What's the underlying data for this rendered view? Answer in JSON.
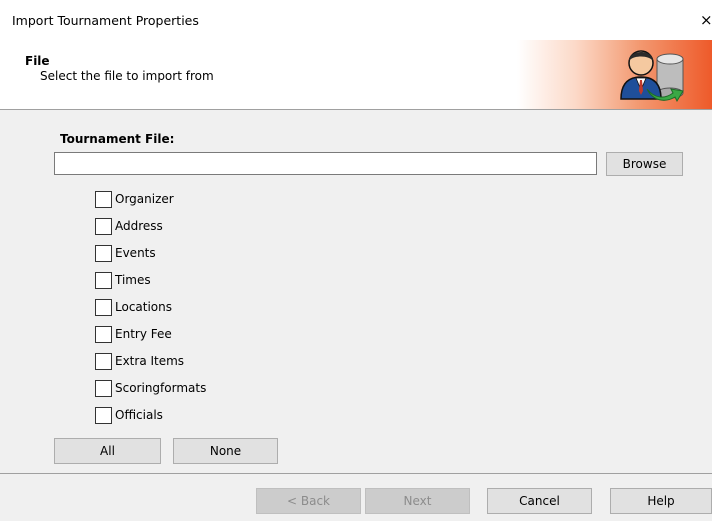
{
  "window": {
    "title": "Import Tournament Properties",
    "close_glyph": "×"
  },
  "header": {
    "title": "File",
    "subtitle": "Select the file to import from",
    "icon": "user-database-arrow-icon"
  },
  "form": {
    "file_label": "Tournament File:",
    "file_value": "",
    "browse_label": "Browse"
  },
  "checkboxes": [
    {
      "label": "Organizer",
      "checked": false
    },
    {
      "label": "Address",
      "checked": false
    },
    {
      "label": "Events",
      "checked": false
    },
    {
      "label": "Times",
      "checked": false
    },
    {
      "label": "Locations",
      "checked": false
    },
    {
      "label": "Entry Fee",
      "checked": false
    },
    {
      "label": "Extra Items",
      "checked": false
    },
    {
      "label": "Scoringformats",
      "checked": false
    },
    {
      "label": "Officials",
      "checked": false
    }
  ],
  "select_buttons": {
    "all": "All",
    "none": "None"
  },
  "footer": {
    "back": "< Back",
    "next": "Next",
    "cancel": "Cancel",
    "help": "Help"
  },
  "colors": {
    "header_gradient_end": "#ee5a2a",
    "dialog_bg": "#f0f0f0"
  }
}
